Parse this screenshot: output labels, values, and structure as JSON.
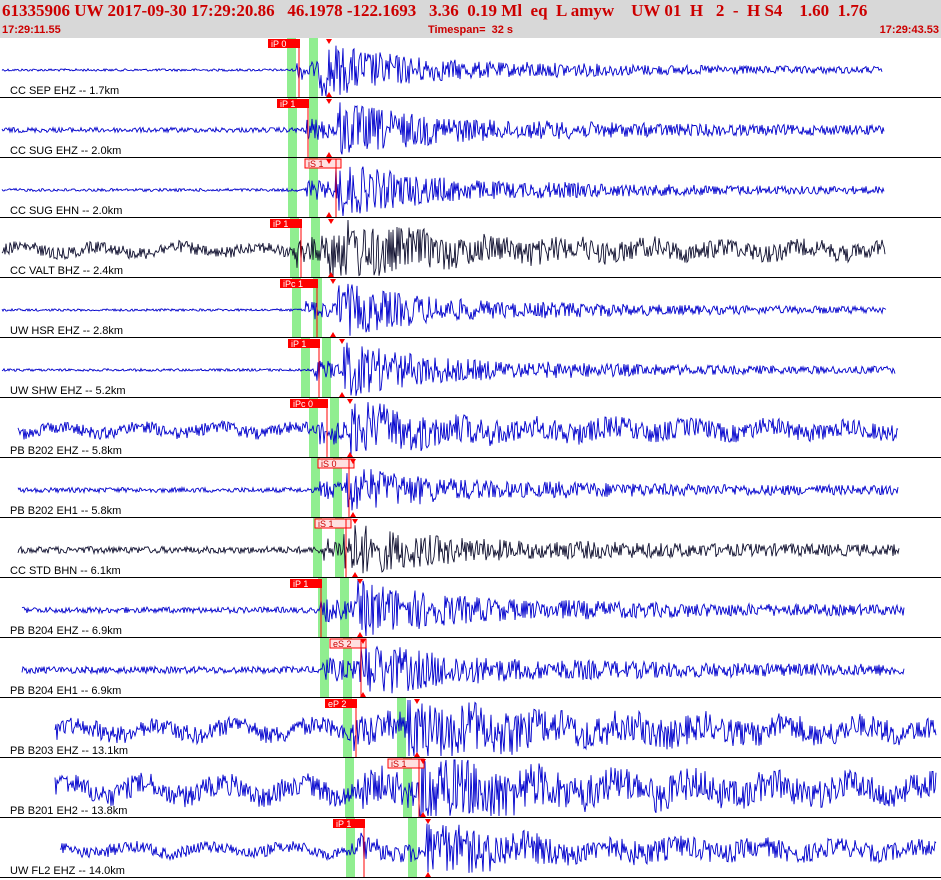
{
  "header": {
    "title_line": "61335906 UW 2017-09-30 17:29:20.86   46.1978 -122.1693   3.36  0.19 Ml  eq  L amyw    UW 01  H   2  -  H S4    1.60  1.76",
    "start_time": "17:29:11.55",
    "timespan": "Timespan=  32 s",
    "end_time": "17:29:43.53"
  },
  "colors": {
    "blue_trace": "#0000cc",
    "black_trace": "#101030",
    "pick_red": "#ff0000",
    "window_green": "#90ee90",
    "header_text": "#cc0000"
  },
  "channels": [
    {
      "label": "CC SEP EHZ -- 1.7km",
      "color": "blue",
      "pick": "iP 0",
      "pick_type": "P"
    },
    {
      "label": "CC SUG EHZ -- 2.0km",
      "color": "blue",
      "pick": "iP 1",
      "pick_type": "P"
    },
    {
      "label": "CC SUG EHN -- 2.0km",
      "color": "blue",
      "pick": "iS 1",
      "pick_type": "S"
    },
    {
      "label": "CC VALT BHZ -- 2.4km",
      "color": "black",
      "pick": "iP 1",
      "pick_type": "P"
    },
    {
      "label": "UW HSR EHZ -- 2.8km",
      "color": "blue",
      "pick": "iPc 1",
      "pick_type": "P"
    },
    {
      "label": "UW SHW EHZ -- 5.2km",
      "color": "blue",
      "pick": "iP 1",
      "pick_type": "P"
    },
    {
      "label": "PB B202 EHZ -- 5.8km",
      "color": "blue",
      "pick": "iPc 0",
      "pick_type": "P"
    },
    {
      "label": "PB B202 EH1 -- 5.8km",
      "color": "blue",
      "pick": "iS 0",
      "pick_type": "S"
    },
    {
      "label": "CC STD BHN -- 6.1km",
      "color": "black",
      "pick": "iS 1",
      "pick_type": "S"
    },
    {
      "label": "PB B204 EHZ -- 6.9km",
      "color": "blue",
      "pick": "iP 1",
      "pick_type": "P"
    },
    {
      "label": "PB B204 EH1 -- 6.9km",
      "color": "blue",
      "pick": "eS 2",
      "pick_type": "S"
    },
    {
      "label": "PB B203 EHZ -- 13.1km",
      "color": "blue",
      "pick": "eP 2",
      "pick_type": "P"
    },
    {
      "label": "PB B201 EH2 -- 13.8km",
      "color": "blue",
      "pick": "iS 1",
      "pick_type": "S"
    },
    {
      "label": "UW FL2 EHZ -- 14.0km",
      "color": "blue",
      "pick": "iP 1",
      "pick_type": "P"
    }
  ]
}
